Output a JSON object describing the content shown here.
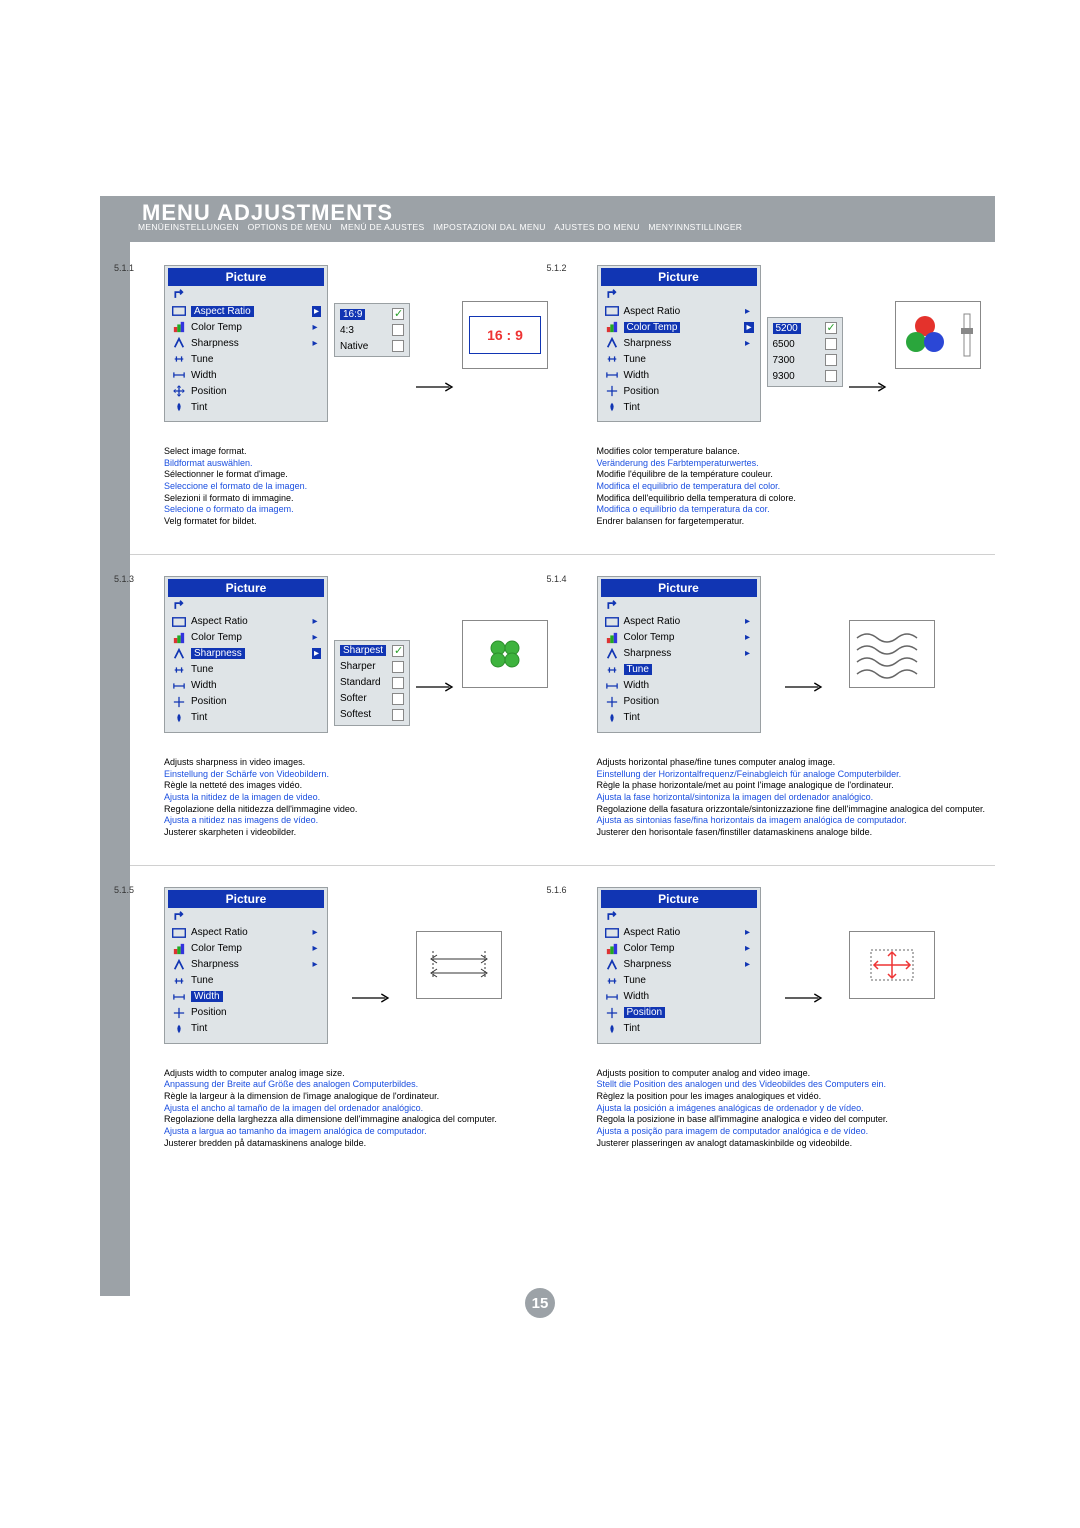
{
  "header": {
    "title": "MENU ADJUSTMENTS",
    "sub": [
      "MENÜEINSTELLUNGEN",
      "OPTIONS DE MENU",
      "MENÚ DE AJUSTES",
      "IMPOSTAZIONI DAL MENU",
      "AJUSTES DO MENU",
      "MENYINNSTILLINGER"
    ]
  },
  "sections": {
    "s511": {
      "num": "5.1.1",
      "menu_title": "Picture",
      "items": [
        "Aspect Ratio",
        "Color Temp",
        "Sharpness",
        "Tune",
        "Width",
        "Position",
        "Tint"
      ],
      "sel": "Aspect Ratio",
      "submenu": [
        "16:9",
        "4:3",
        "Native"
      ],
      "sub_sel": "16:9",
      "preview_label": "16 : 9",
      "desc": [
        {
          "txt": "Select image format.",
          "cls": ""
        },
        {
          "txt": "Bildformat auswählen.",
          "cls": "blue"
        },
        {
          "txt": "Sélectionner le format d'image.",
          "cls": ""
        },
        {
          "txt": "Seleccione el formato de la imagen.",
          "cls": "blue"
        },
        {
          "txt": "Selezioni il formato di immagine.",
          "cls": ""
        },
        {
          "txt": "Selecione o formato da imagem.",
          "cls": "blue"
        },
        {
          "txt": "Velg formatet for bildet.",
          "cls": ""
        }
      ]
    },
    "s512": {
      "num": "5.1.2",
      "menu_title": "Picture",
      "items": [
        "Aspect Ratio",
        "Color Temp",
        "Sharpness",
        "Tune",
        "Width",
        "Position",
        "Tint"
      ],
      "sel": "Color Temp",
      "submenu": [
        "5200",
        "6500",
        "7300",
        "9300"
      ],
      "sub_sel": "5200",
      "desc": [
        {
          "txt": "Modifies color temperature balance.",
          "cls": ""
        },
        {
          "txt": "Veränderung des Farbtemperaturwertes.",
          "cls": "blue"
        },
        {
          "txt": "Modifie l'équilibre de la température couleur.",
          "cls": ""
        },
        {
          "txt": "Modifica el equilibrio de temperatura del color.",
          "cls": "blue"
        },
        {
          "txt": "Modifica dell'equilibrio della temperatura di colore.",
          "cls": ""
        },
        {
          "txt": "Modifica o equilíbrio da temperatura da cor.",
          "cls": "blue"
        },
        {
          "txt": "Endrer balansen for fargetemperatur.",
          "cls": ""
        }
      ]
    },
    "s513": {
      "num": "5.1.3",
      "menu_title": "Picture",
      "items": [
        "Aspect Ratio",
        "Color Temp",
        "Sharpness",
        "Tune",
        "Width",
        "Position",
        "Tint"
      ],
      "sel": "Sharpness",
      "submenu": [
        "Sharpest",
        "Sharper",
        "Standard",
        "Softer",
        "Softest"
      ],
      "sub_sel": "Sharpest",
      "desc": [
        {
          "txt": "Adjusts sharpness in video images.",
          "cls": ""
        },
        {
          "txt": "Einstellung der Schärfe von Videobildern.",
          "cls": "blue"
        },
        {
          "txt": "Règle la netteté des images vidéo.",
          "cls": ""
        },
        {
          "txt": "Ajusta la nitidez de la imagen de video.",
          "cls": "blue"
        },
        {
          "txt": "Regolazione della nitidezza dell'immagine video.",
          "cls": ""
        },
        {
          "txt": "Ajusta a nitidez nas imagens de vídeo.",
          "cls": "blue"
        },
        {
          "txt": "Justerer skarpheten i videobilder.",
          "cls": ""
        }
      ]
    },
    "s514": {
      "num": "5.1.4",
      "menu_title": "Picture",
      "items": [
        "Aspect Ratio",
        "Color Temp",
        "Sharpness",
        "Tune",
        "Width",
        "Position",
        "Tint"
      ],
      "sel": "Tune",
      "desc": [
        {
          "txt": "Adjusts horizontal phase/fine tunes computer analog image.",
          "cls": ""
        },
        {
          "txt": "Einstellung der Horizontalfrequenz/Feinabgleich für analoge Computerbilder.",
          "cls": "blue"
        },
        {
          "txt": "Règle la phase horizontale/met au point l'image analogique de l'ordinateur.",
          "cls": ""
        },
        {
          "txt": "Ajusta la fase horizontal/sintoniza la imagen del ordenador analógico.",
          "cls": "blue"
        },
        {
          "txt": "Regolazione della fasatura orizzontale/sintonizzazione fine dell'immagine analogica del computer.",
          "cls": ""
        },
        {
          "txt": "Ajusta as sintonias fase/fina horizontais da imagem analógica de computador.",
          "cls": "blue"
        },
        {
          "txt": "Justerer den horisontale fasen/finstiller datamaskinens analoge bilde.",
          "cls": ""
        }
      ]
    },
    "s515": {
      "num": "5.1.5",
      "menu_title": "Picture",
      "items": [
        "Aspect Ratio",
        "Color Temp",
        "Sharpness",
        "Tune",
        "Width",
        "Position",
        "Tint"
      ],
      "sel": "Width",
      "desc": [
        {
          "txt": "Adjusts width to computer analog image size.",
          "cls": ""
        },
        {
          "txt": "Anpassung der Breite auf Größe des analogen Computerbildes.",
          "cls": "blue"
        },
        {
          "txt": "Règle la largeur à la dimension de l'image analogique de l'ordinateur.",
          "cls": ""
        },
        {
          "txt": "Ajusta el ancho al tamaño de la imagen del ordenador analógico.",
          "cls": "blue"
        },
        {
          "txt": "Regolazione della larghezza alla dimensione dell'immagine analogica del computer.",
          "cls": ""
        },
        {
          "txt": "Ajusta a largua ao tamanho da imagem analógica de computador.",
          "cls": "blue"
        },
        {
          "txt": "Justerer bredden på datamaskinens analoge bilde.",
          "cls": ""
        }
      ]
    },
    "s516": {
      "num": "5.1.6",
      "menu_title": "Picture",
      "items": [
        "Aspect Ratio",
        "Color Temp",
        "Sharpness",
        "Tune",
        "Width",
        "Position",
        "Tint"
      ],
      "sel": "Position",
      "desc": [
        {
          "txt": "Adjusts position to computer analog and video image.",
          "cls": ""
        },
        {
          "txt": "Stellt die Position des analogen und des Videobildes des Computers ein.",
          "cls": "blue"
        },
        {
          "txt": "Règlez la position pour les images analogiques et vidéo.",
          "cls": ""
        },
        {
          "txt": "Ajusta la posición a imágenes analógicas de ordenador y de vídeo.",
          "cls": "blue"
        },
        {
          "txt": "Regola la posizione in base all'immagine analogica e video del computer.",
          "cls": ""
        },
        {
          "txt": "Ajusta a posição para imagem de computador analógica e de vídeo.",
          "cls": "blue"
        },
        {
          "txt": "Justerer plasseringen av analogt datamaskinbilde og videobilde.",
          "cls": ""
        }
      ]
    }
  },
  "page_number": "15"
}
